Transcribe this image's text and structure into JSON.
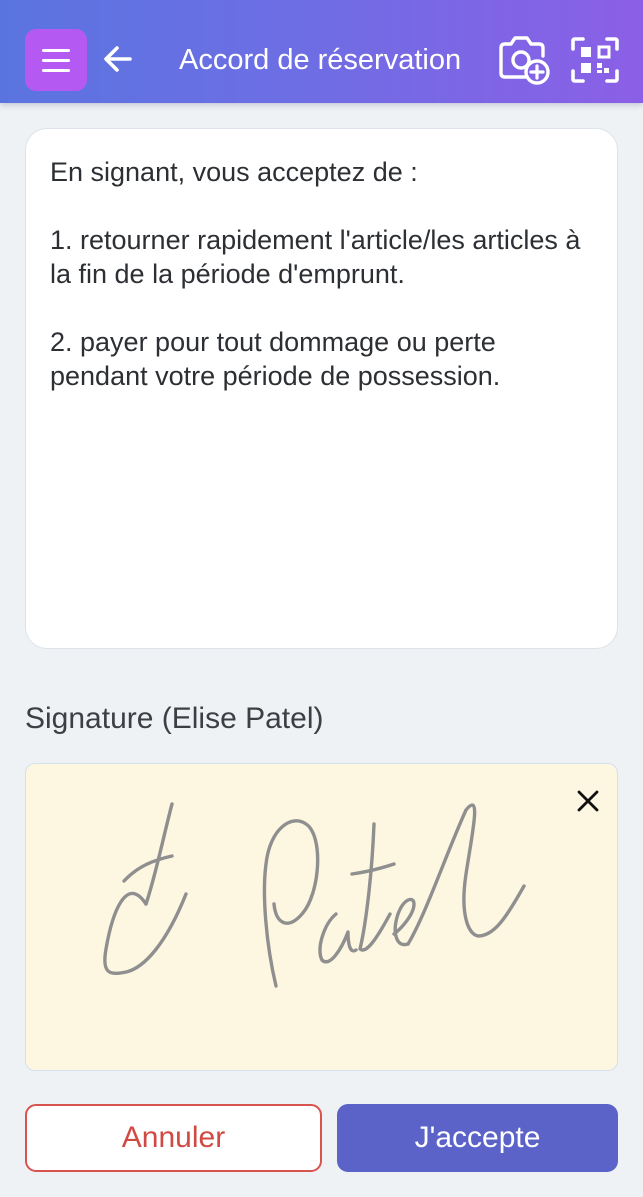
{
  "header": {
    "title": "Accord de réservation",
    "menu_icon": "hamburger-menu-icon",
    "back_icon": "arrow-left-icon",
    "camera_icon": "camera-add-icon",
    "qr_icon": "qr-scan-icon"
  },
  "agreement": {
    "intro": "En signant, vous acceptez de :",
    "item1": "1. retourner rapidement l'article/les articles à la fin de la période d'emprunt.",
    "item2": "2. payer pour tout dommage ou perte pendant votre période de possession."
  },
  "signature": {
    "label": "Signature (Elise Patel)",
    "clear_icon": "close-icon"
  },
  "actions": {
    "cancel_label": "Annuler",
    "accept_label": "J'accepte"
  },
  "colors": {
    "header_gradient_start": "#5a74df",
    "header_gradient_end": "#8b5fe6",
    "menu_button": "#b45af2",
    "signature_bg": "#fdf6e1",
    "cancel": "#d04a43",
    "accept": "#5b63c8"
  }
}
